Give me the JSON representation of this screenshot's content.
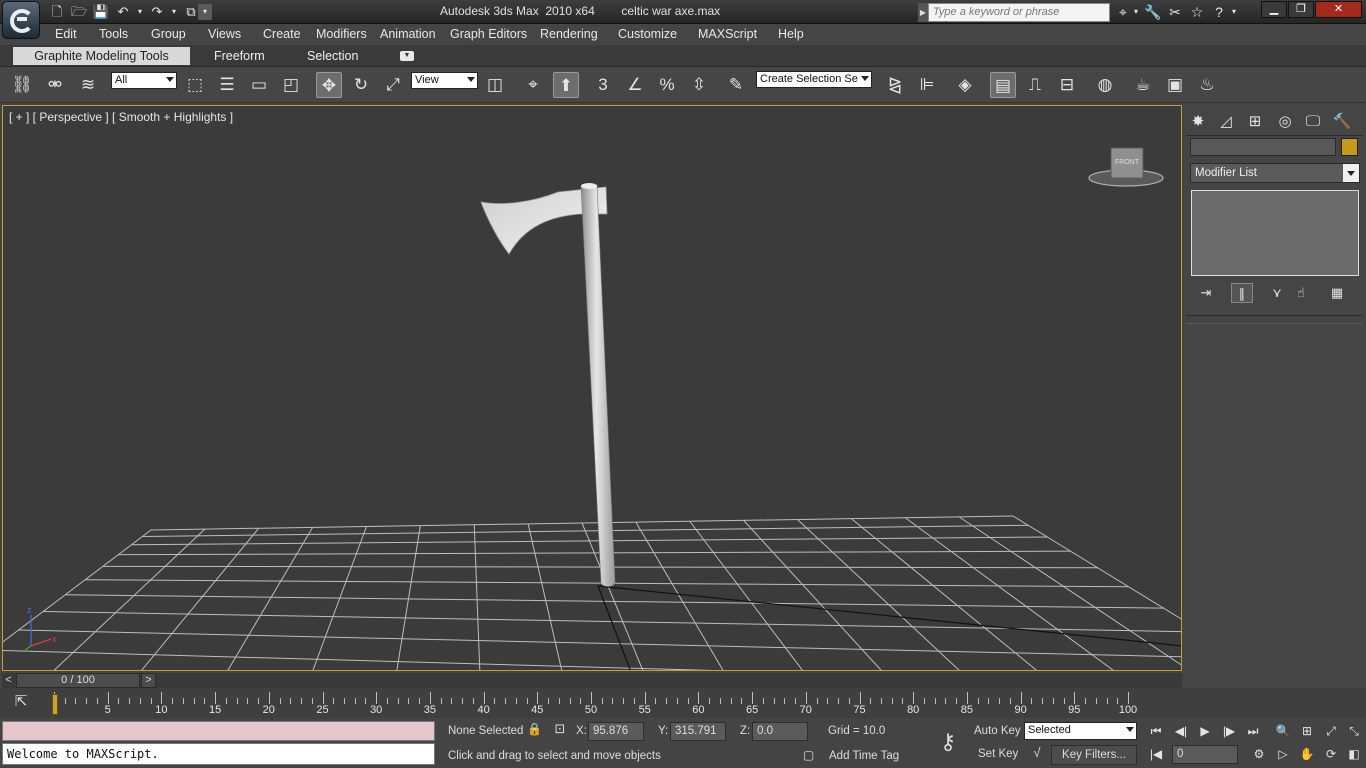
{
  "window": {
    "title": "Autodesk 3ds Max  2010 x64        celtic war axe.max",
    "search_placeholder": "Type a keyword or phrase",
    "controls": {
      "minimize": "▁",
      "restore": "❐",
      "close": "✕"
    }
  },
  "quick_access": [
    "new-file-icon",
    "open-file-icon",
    "save-icon",
    "undo-icon",
    "redo-icon",
    "project-folder-icon"
  ],
  "menu": {
    "items": [
      "Edit",
      "Tools",
      "Group",
      "Views",
      "Create",
      "Modifiers",
      "Animation",
      "Graph Editors",
      "Rendering",
      "Customize",
      "MAXScript",
      "Help"
    ]
  },
  "ribbon": {
    "tabs": [
      "Graphite Modeling Tools",
      "Freeform",
      "Selection"
    ],
    "active_tab": "Graphite Modeling Tools"
  },
  "toolbar": {
    "selection_filter": "All",
    "reference_coord": "View",
    "named_selection": "Create Selection Se",
    "snap_values": {
      "snap3": "3",
      "percent": "%"
    }
  },
  "viewport": {
    "label": "[ + ] [ Perspective ] [ Smooth + Highlights ]",
    "viewcube_label": "FRONT",
    "axis_labels": {
      "x": "x",
      "z": "z"
    }
  },
  "command_panel": {
    "modifier_list": "Modifier List",
    "object_color": "#c69b1d"
  },
  "time_slider": {
    "position": "0 / 100",
    "prev": "<",
    "next": ">"
  },
  "trackbar": {
    "ticks": [
      0,
      5,
      10,
      15,
      20,
      25,
      30,
      35,
      40,
      45,
      50,
      55,
      60,
      65,
      70,
      75,
      80,
      85,
      90,
      95,
      100
    ],
    "labels": [
      "",
      "5",
      "10",
      "15",
      "20",
      "25",
      "30",
      "35",
      "40",
      "45",
      "50",
      "55",
      "60",
      "65",
      "70",
      "75",
      "80",
      "85",
      "90",
      "95",
      "100"
    ]
  },
  "status": {
    "maxscript_output": "Welcome to MAXScript.",
    "selection": "None Selected",
    "x_label": "X:",
    "x_value": "95.876",
    "y_label": "Y:",
    "y_value": "315.791",
    "z_label": "Z:",
    "z_value": "0.0",
    "grid": "Grid = 10.0",
    "prompt": "Click and drag to select and move objects",
    "add_time_tag": "Add Time Tag",
    "auto_key": "Auto Key",
    "set_key": "Set Key",
    "key_mode": "Selected",
    "key_filters": "Key Filters...",
    "current_frame": "0"
  }
}
